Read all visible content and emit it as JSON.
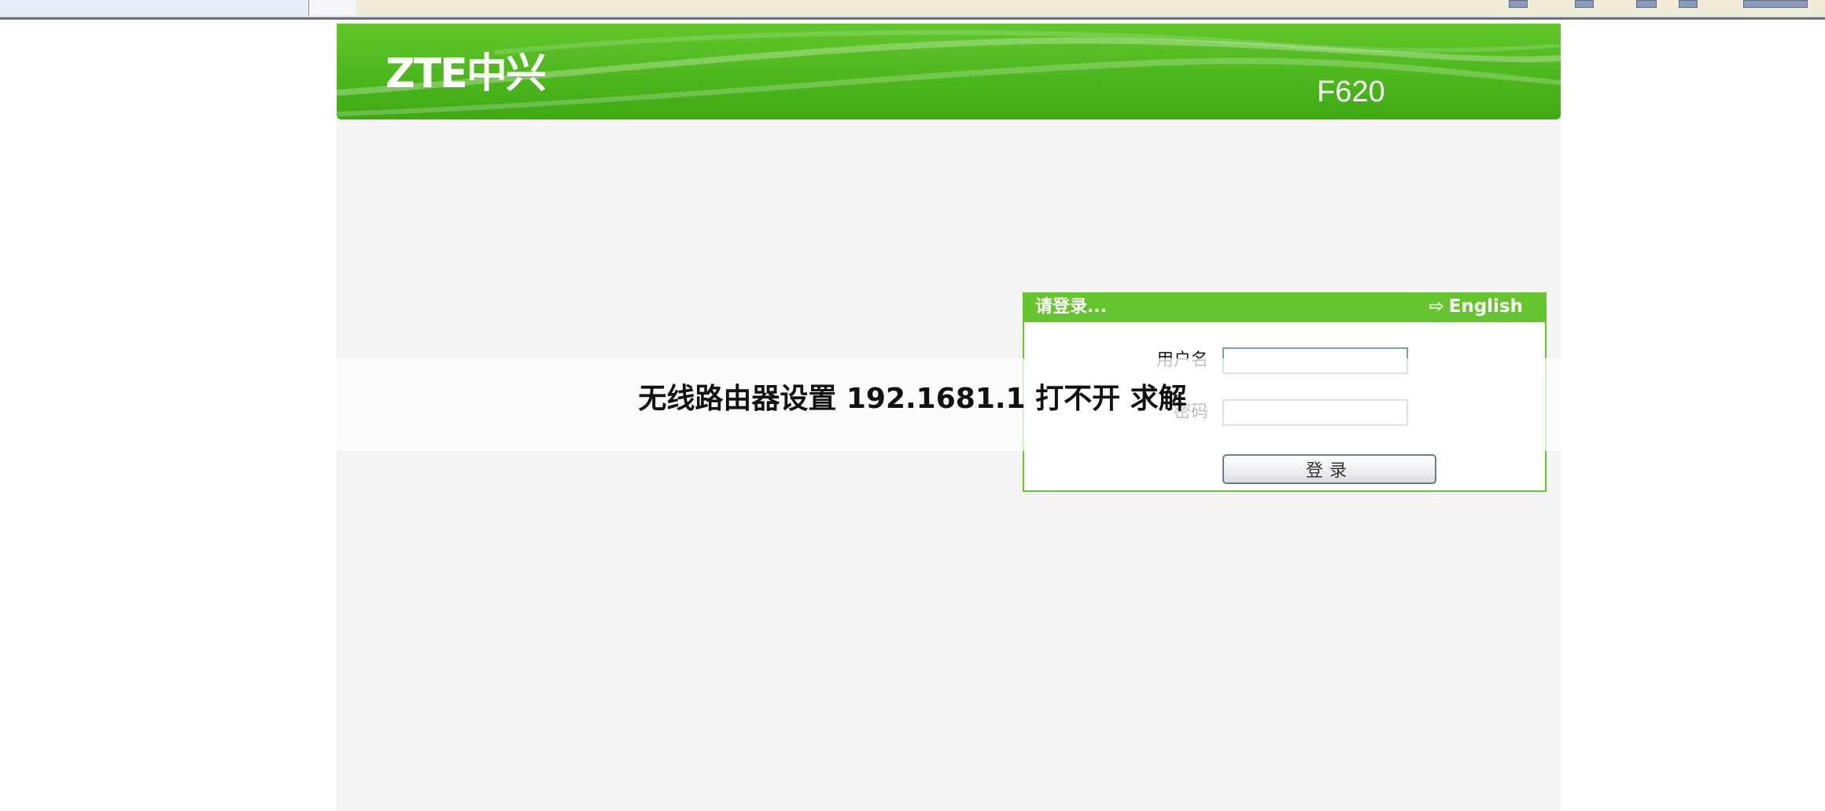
{
  "colors": {
    "brand_green": "#4db71d",
    "header_green": "#66c42f",
    "page_bg": "#f4f4f4"
  },
  "banner": {
    "logo_text": "ZTE中兴",
    "model": "F620"
  },
  "login": {
    "title": "请登录...",
    "language_link": "English",
    "language_icon": "arrow-right-icon",
    "username_label": "用户名",
    "password_label": "密码",
    "username_value": "",
    "password_value": "",
    "submit_label": "登录"
  },
  "overlay": {
    "caption": "无线路由器设置 192.1681.1 打不开 求解"
  }
}
